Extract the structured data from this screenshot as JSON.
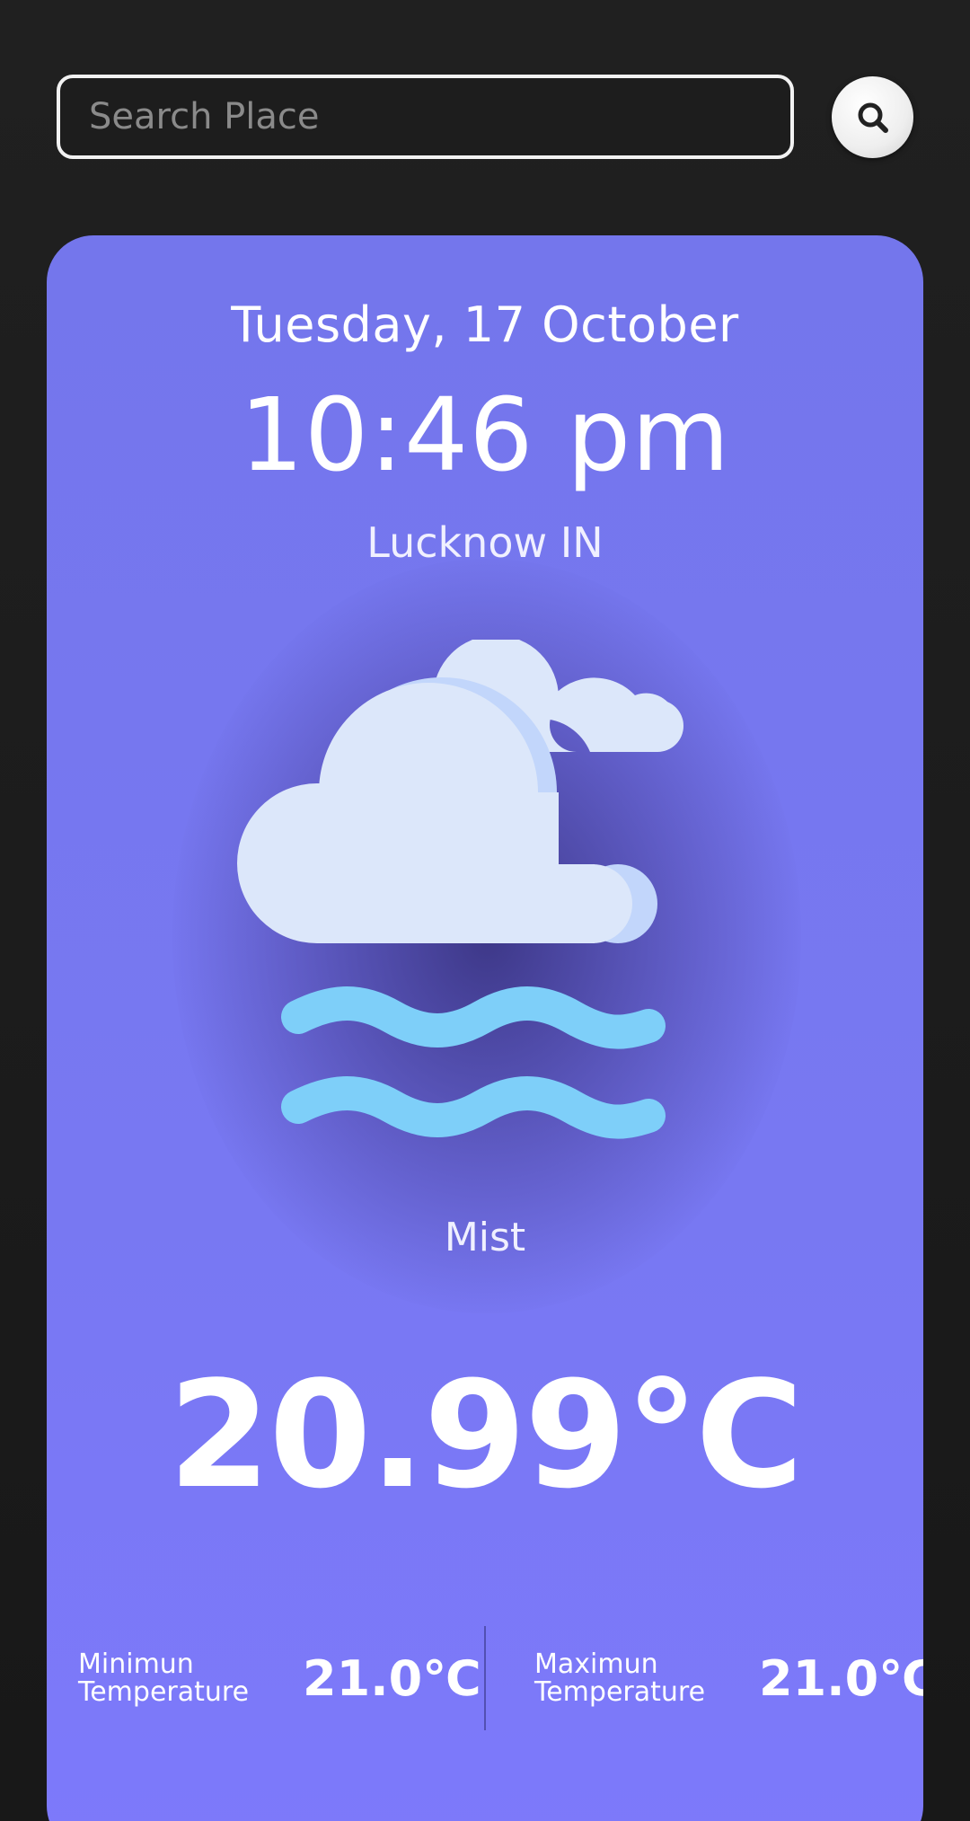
{
  "search": {
    "placeholder": "Search Place",
    "value": ""
  },
  "icons": {
    "search_button": "search-icon",
    "weather": "mist-icon"
  },
  "weather": {
    "date": "Tuesday, 17 October",
    "time": "10:46 pm",
    "location": "Lucknow IN",
    "condition": "Mist",
    "temperature": "20.99℃",
    "min": {
      "label_line1": "Minimun",
      "label_line2": "Temperature",
      "value": "21.0℃"
    },
    "max": {
      "label_line1": "Maximun",
      "label_line2": "Temperature",
      "value": "21.0℃"
    }
  },
  "colors": {
    "background": "#1b1b1b",
    "card": "#7878f2",
    "cloud": "#dce7fa",
    "cloud_shade": "#c2d6fb",
    "mist_waves": "#7ecff9"
  }
}
